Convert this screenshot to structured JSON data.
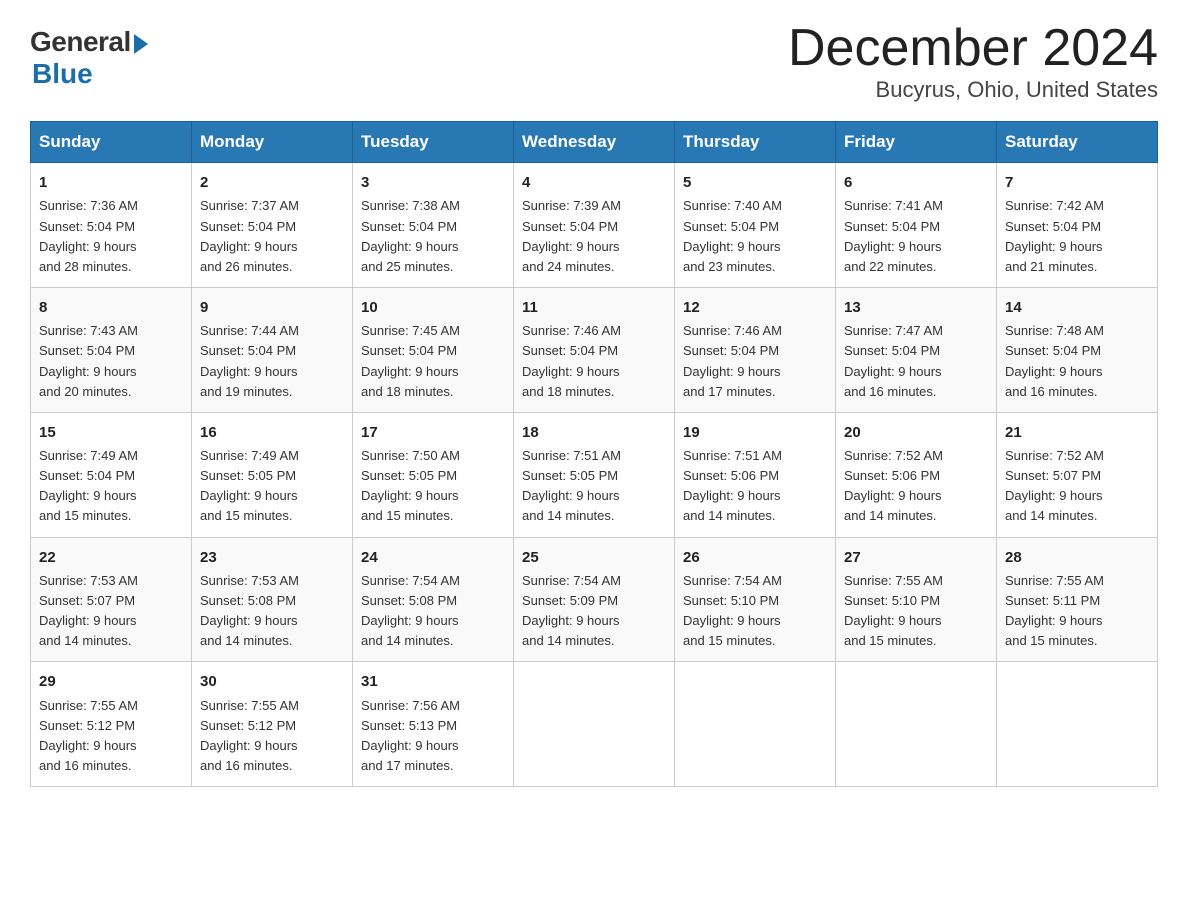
{
  "header": {
    "logo_general": "General",
    "logo_blue": "Blue",
    "month_title": "December 2024",
    "location": "Bucyrus, Ohio, United States"
  },
  "days_of_week": [
    "Sunday",
    "Monday",
    "Tuesday",
    "Wednesday",
    "Thursday",
    "Friday",
    "Saturday"
  ],
  "weeks": [
    [
      {
        "day": "1",
        "sunrise": "7:36 AM",
        "sunset": "5:04 PM",
        "daylight": "9 hours and 28 minutes."
      },
      {
        "day": "2",
        "sunrise": "7:37 AM",
        "sunset": "5:04 PM",
        "daylight": "9 hours and 26 minutes."
      },
      {
        "day": "3",
        "sunrise": "7:38 AM",
        "sunset": "5:04 PM",
        "daylight": "9 hours and 25 minutes."
      },
      {
        "day": "4",
        "sunrise": "7:39 AM",
        "sunset": "5:04 PM",
        "daylight": "9 hours and 24 minutes."
      },
      {
        "day": "5",
        "sunrise": "7:40 AM",
        "sunset": "5:04 PM",
        "daylight": "9 hours and 23 minutes."
      },
      {
        "day": "6",
        "sunrise": "7:41 AM",
        "sunset": "5:04 PM",
        "daylight": "9 hours and 22 minutes."
      },
      {
        "day": "7",
        "sunrise": "7:42 AM",
        "sunset": "5:04 PM",
        "daylight": "9 hours and 21 minutes."
      }
    ],
    [
      {
        "day": "8",
        "sunrise": "7:43 AM",
        "sunset": "5:04 PM",
        "daylight": "9 hours and 20 minutes."
      },
      {
        "day": "9",
        "sunrise": "7:44 AM",
        "sunset": "5:04 PM",
        "daylight": "9 hours and 19 minutes."
      },
      {
        "day": "10",
        "sunrise": "7:45 AM",
        "sunset": "5:04 PM",
        "daylight": "9 hours and 18 minutes."
      },
      {
        "day": "11",
        "sunrise": "7:46 AM",
        "sunset": "5:04 PM",
        "daylight": "9 hours and 18 minutes."
      },
      {
        "day": "12",
        "sunrise": "7:46 AM",
        "sunset": "5:04 PM",
        "daylight": "9 hours and 17 minutes."
      },
      {
        "day": "13",
        "sunrise": "7:47 AM",
        "sunset": "5:04 PM",
        "daylight": "9 hours and 16 minutes."
      },
      {
        "day": "14",
        "sunrise": "7:48 AM",
        "sunset": "5:04 PM",
        "daylight": "9 hours and 16 minutes."
      }
    ],
    [
      {
        "day": "15",
        "sunrise": "7:49 AM",
        "sunset": "5:04 PM",
        "daylight": "9 hours and 15 minutes."
      },
      {
        "day": "16",
        "sunrise": "7:49 AM",
        "sunset": "5:05 PM",
        "daylight": "9 hours and 15 minutes."
      },
      {
        "day": "17",
        "sunrise": "7:50 AM",
        "sunset": "5:05 PM",
        "daylight": "9 hours and 15 minutes."
      },
      {
        "day": "18",
        "sunrise": "7:51 AM",
        "sunset": "5:05 PM",
        "daylight": "9 hours and 14 minutes."
      },
      {
        "day": "19",
        "sunrise": "7:51 AM",
        "sunset": "5:06 PM",
        "daylight": "9 hours and 14 minutes."
      },
      {
        "day": "20",
        "sunrise": "7:52 AM",
        "sunset": "5:06 PM",
        "daylight": "9 hours and 14 minutes."
      },
      {
        "day": "21",
        "sunrise": "7:52 AM",
        "sunset": "5:07 PM",
        "daylight": "9 hours and 14 minutes."
      }
    ],
    [
      {
        "day": "22",
        "sunrise": "7:53 AM",
        "sunset": "5:07 PM",
        "daylight": "9 hours and 14 minutes."
      },
      {
        "day": "23",
        "sunrise": "7:53 AM",
        "sunset": "5:08 PM",
        "daylight": "9 hours and 14 minutes."
      },
      {
        "day": "24",
        "sunrise": "7:54 AM",
        "sunset": "5:08 PM",
        "daylight": "9 hours and 14 minutes."
      },
      {
        "day": "25",
        "sunrise": "7:54 AM",
        "sunset": "5:09 PM",
        "daylight": "9 hours and 14 minutes."
      },
      {
        "day": "26",
        "sunrise": "7:54 AM",
        "sunset": "5:10 PM",
        "daylight": "9 hours and 15 minutes."
      },
      {
        "day": "27",
        "sunrise": "7:55 AM",
        "sunset": "5:10 PM",
        "daylight": "9 hours and 15 minutes."
      },
      {
        "day": "28",
        "sunrise": "7:55 AM",
        "sunset": "5:11 PM",
        "daylight": "9 hours and 15 minutes."
      }
    ],
    [
      {
        "day": "29",
        "sunrise": "7:55 AM",
        "sunset": "5:12 PM",
        "daylight": "9 hours and 16 minutes."
      },
      {
        "day": "30",
        "sunrise": "7:55 AM",
        "sunset": "5:12 PM",
        "daylight": "9 hours and 16 minutes."
      },
      {
        "day": "31",
        "sunrise": "7:56 AM",
        "sunset": "5:13 PM",
        "daylight": "9 hours and 17 minutes."
      },
      null,
      null,
      null,
      null
    ]
  ],
  "labels": {
    "sunrise": "Sunrise:",
    "sunset": "Sunset:",
    "daylight": "Daylight:"
  }
}
